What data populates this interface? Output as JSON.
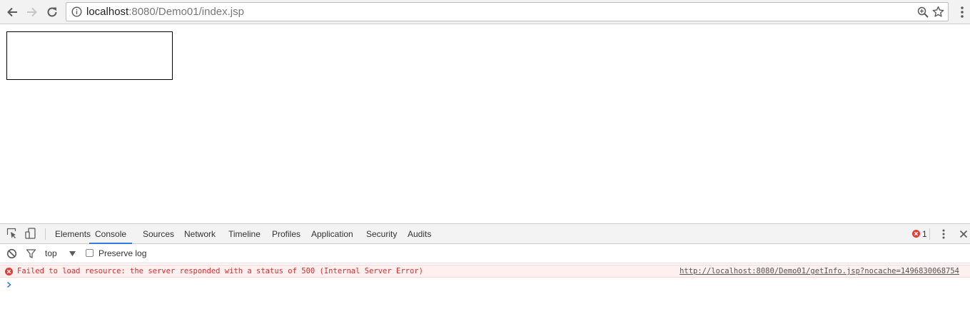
{
  "browser": {
    "url_host": "localhost",
    "url_rest": ":8080/Demo01/index.jsp",
    "icons": [
      "back-arrow-icon",
      "forward-arrow-icon",
      "reload-icon",
      "info-icon",
      "zoom-icon",
      "star-icon",
      "more-vert-icon"
    ]
  },
  "devtools": {
    "tabs": [
      "Elements",
      "Console",
      "Sources",
      "Network",
      "Timeline",
      "Profiles",
      "Application",
      "Security",
      "Audits"
    ],
    "active_tab": "Console",
    "error_count": "1",
    "context": "top",
    "preserve_log_label": "Preserve log",
    "preserve_log_checked": false,
    "colors": {
      "error_text": "#d82b2b",
      "error_bg": "#fff0f0",
      "active_tab_underline": "#3879d9"
    }
  },
  "console": {
    "messages": [
      {
        "level": "error",
        "text": "Failed to load resource: the server responded with a status of 500 (Internal Server Error)",
        "source": "http://localhost:8080/Demo01/getInfo.jsp?nocache=1496830068754"
      }
    ]
  }
}
